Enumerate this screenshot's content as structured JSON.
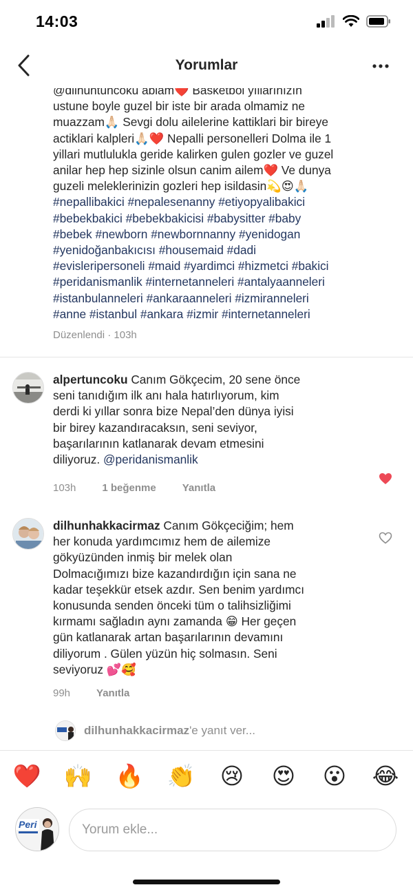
{
  "status_bar": {
    "time": "14:03"
  },
  "nav": {
    "title": "Yorumlar",
    "back_icon": "chevron-left-icon",
    "more_icon": "more-horizontal-icon"
  },
  "caption": {
    "text_line_0": "@dilhuntuncoku ablam❤️ Basketbol yıllarınızın",
    "text_line_1": "ustune boyle guzel bir iste bir arada olmamiz ne",
    "text_line_2": "muazzam🙏🏻 Sevgi dolu ailelerine kattiklari bir bireye",
    "text_line_3": "actiklari kalpleri🙏🏻❤️ Nepalli personelleri Dolma ile 1",
    "text_line_4": "yillari mutlulukla geride kalirken gulen gozler ve guzel",
    "text_line_5": "anilar hep hep sizinle olsun canim ailem❤️ Ve dunya",
    "text_line_6": "guzeli meleklerinizin gozleri hep isildasin💫😍🙏🏻",
    "tags_line_0": "#nepallibakici #nepalesenanny #etiyopyalibakici",
    "tags_line_1": "#bebekbakici #bebekbakicisi #babysitter #baby",
    "tags_line_2": "#bebek #newborn #newbornnanny #yenidogan",
    "tags_line_3": "#yenidoğanbakıcısı #housemaid #dadi",
    "tags_line_4": "#evisleripersoneli #maid #yardimci #hizmetci #bakici",
    "tags_line_5": "#peridanismanlik #internetanneleri #antalyaanneleri",
    "tags_line_6": "#istanbulanneleri #ankaraanneleri #izmiranneleri",
    "tags_line_7": "#anne #istanbul #ankara #izmir #internetanneleri",
    "meta": "Düzenlendi · 103h"
  },
  "comments": [
    {
      "username": "alpertuncoku",
      "line_0": " Canım Gökçecim, 20 sene önce",
      "line_1": "seni tanıdığım ilk anı hala hatırlıyorum, kim",
      "line_2": "derdi ki yıllar sonra bize Nepal’den dünya iyisi",
      "line_3": "bir birey kazandıracaksın, seni seviyor,",
      "line_4": "başarılarının katlanarak devam etmesini",
      "line_5": "diliyoruz. ",
      "mention": "@peridanismanlik",
      "time": "103h",
      "likes": "1 beğenme",
      "reply": "Yanıtla",
      "liked": true
    },
    {
      "username": "dilhunhakkacirmaz",
      "line_0": " Canım Gökçeciğim; hem",
      "line_1": "her konuda yardımcımız hem de ailemize",
      "line_2": "gökyüzünden inmiş bir melek olan",
      "line_3": "Dolmacığımızı bize kazandırdığın için sana ne",
      "line_4": "kadar teşekkür etsek azdır. Sen benim yardımcı",
      "line_5": "konusunda senden önceki tüm o talihsizliğimi",
      "line_6": "kırmamı sağladın aynı zamanda 😁 Her geçen",
      "line_7": "gün katlanarak artan başarılarının devamını",
      "line_8": "diliyorum .  Gülen yüzün hiç solmasın. Seni",
      "line_9": "seviyoruz 💕🥰",
      "time": "99h",
      "reply": "Yanıtla",
      "liked": false
    }
  ],
  "reply_prompt": {
    "username": "dilhunhakkacirmaz",
    "suffix": "'e yanıt ver..."
  },
  "emoji_bar": [
    "❤️",
    "🙌",
    "🔥",
    "👏",
    "😢",
    "😍",
    "😮",
    "😂"
  ],
  "composer": {
    "placeholder": "Yorum ekle...",
    "avatar_logo": "Peri"
  },
  "colors": {
    "heart_red": "#ed4956",
    "hashtag_blue": "#23365f",
    "meta_gray": "#8e8e8e"
  }
}
